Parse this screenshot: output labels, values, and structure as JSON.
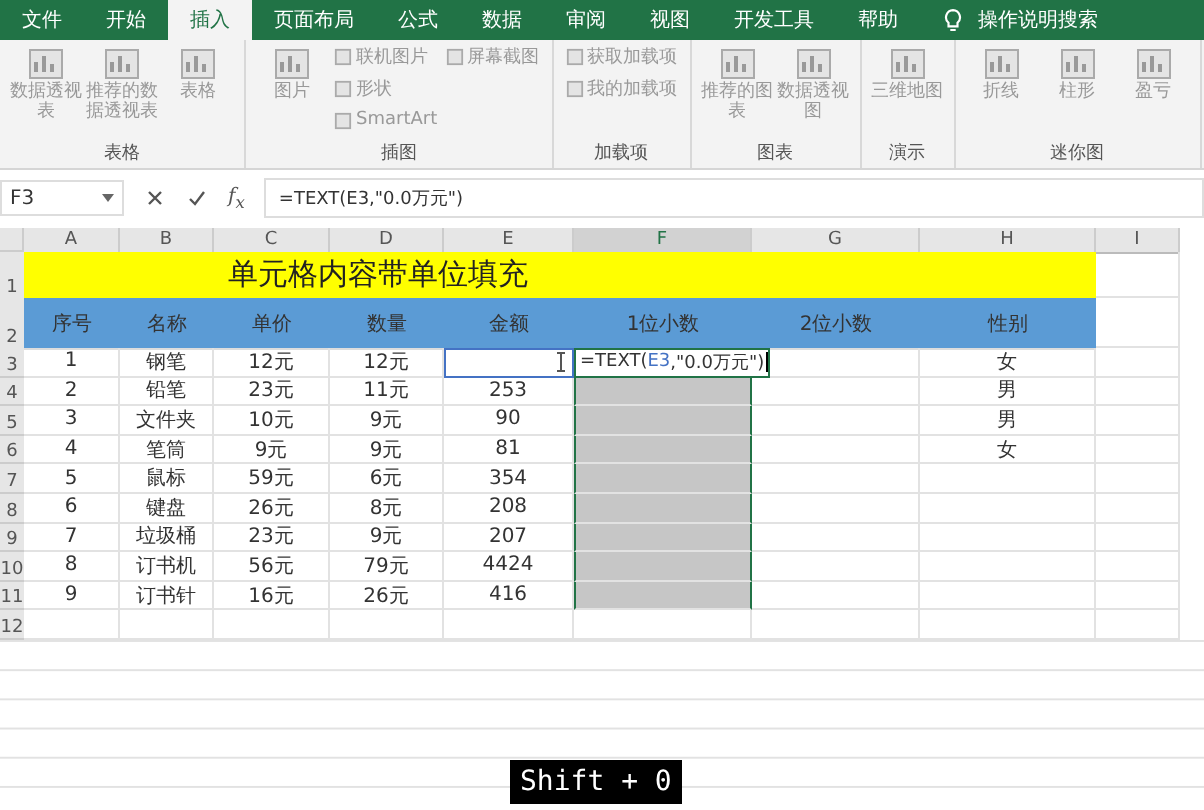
{
  "tabs": [
    {
      "label": "文件",
      "selected": false
    },
    {
      "label": "开始",
      "selected": false
    },
    {
      "label": "插入",
      "selected": true
    },
    {
      "label": "页面布局",
      "selected": false
    },
    {
      "label": "公式",
      "selected": false
    },
    {
      "label": "数据",
      "selected": false
    },
    {
      "label": "审阅",
      "selected": false
    },
    {
      "label": "视图",
      "selected": false
    },
    {
      "label": "开发工具",
      "selected": false
    },
    {
      "label": "帮助",
      "selected": false
    }
  ],
  "tell_me": "操作说明搜索",
  "ribbon_groups": [
    {
      "label": "表格",
      "items": [
        {
          "label": "数据透视表",
          "kind": "large"
        },
        {
          "label": "推荐的数据透视表",
          "kind": "large"
        },
        {
          "label": "表格",
          "kind": "large"
        }
      ]
    },
    {
      "label": "插图",
      "items": [
        {
          "label": "图片",
          "kind": "large"
        },
        {
          "label": "联机图片",
          "kind": "small"
        },
        {
          "label": "形状",
          "kind": "small"
        },
        {
          "label": "SmartArt",
          "kind": "small"
        },
        {
          "label": "屏幕截图",
          "kind": "small"
        }
      ]
    },
    {
      "label": "加载项",
      "items": [
        {
          "label": "获取加载项",
          "kind": "small"
        },
        {
          "label": "我的加载项",
          "kind": "small"
        }
      ]
    },
    {
      "label": "图表",
      "items": [
        {
          "label": "推荐的图表",
          "kind": "large"
        },
        {
          "label": "数据透视图",
          "kind": "large"
        }
      ]
    },
    {
      "label": "演示",
      "items": [
        {
          "label": "三维地图",
          "kind": "large"
        }
      ]
    },
    {
      "label": "迷你图",
      "items": [
        {
          "label": "折线",
          "kind": "large"
        },
        {
          "label": "柱形",
          "kind": "large"
        },
        {
          "label": "盈亏",
          "kind": "large"
        }
      ]
    }
  ],
  "name_box": "F3",
  "formula": "=TEXT(E3,\"0.0万元\")",
  "columns": [
    {
      "label": "A",
      "selected": false
    },
    {
      "label": "B",
      "selected": false
    },
    {
      "label": "C",
      "selected": false
    },
    {
      "label": "D",
      "selected": false
    },
    {
      "label": "E",
      "selected": false
    },
    {
      "label": "F",
      "selected": true
    },
    {
      "label": "G",
      "selected": false
    },
    {
      "label": "H",
      "selected": false
    },
    {
      "label": "I",
      "selected": false
    }
  ],
  "title_row": {
    "number": "1",
    "text": "单元格内容带单位填充"
  },
  "header_row": {
    "number": "2",
    "cells": [
      "序号",
      "名称",
      "单价",
      "数量",
      "金额",
      "1位小数",
      "2位小数",
      "性别"
    ]
  },
  "rows": [
    {
      "number": "3",
      "cells": [
        "1",
        "钢笔",
        "12元",
        "12元",
        "",
        "",
        "",
        "女"
      ],
      "selected": false,
      "formula_parts": [
        {
          "text": "=TEXT(",
          "kind": "plain"
        },
        {
          "text": "E3",
          "kind": "ref"
        },
        {
          "text": ",\"0.0万元\")",
          "kind": "plain"
        }
      ]
    },
    {
      "number": "4",
      "cells": [
        "2",
        "铅笔",
        "23元",
        "11元",
        "253",
        "",
        "",
        "男"
      ],
      "selected": true
    },
    {
      "number": "5",
      "cells": [
        "3",
        "文件夹",
        "10元",
        "9元",
        "90",
        "",
        "",
        "男"
      ],
      "selected": true
    },
    {
      "number": "6",
      "cells": [
        "4",
        "笔筒",
        "9元",
        "9元",
        "81",
        "",
        "",
        "女"
      ],
      "selected": true
    },
    {
      "number": "7",
      "cells": [
        "5",
        "鼠标",
        "59元",
        "6元",
        "354",
        "",
        "",
        ""
      ],
      "selected": true
    },
    {
      "number": "8",
      "cells": [
        "6",
        "键盘",
        "26元",
        "8元",
        "208",
        "",
        "",
        ""
      ],
      "selected": true
    },
    {
      "number": "9",
      "cells": [
        "7",
        "垃圾桶",
        "23元",
        "9元",
        "207",
        "",
        "",
        ""
      ],
      "selected": true
    },
    {
      "number": "10",
      "cells": [
        "8",
        "订书机",
        "56元",
        "79元",
        "4424",
        "",
        "",
        ""
      ],
      "selected": true
    },
    {
      "number": "11",
      "cells": [
        "9",
        "订书针",
        "16元",
        "26元",
        "416",
        "",
        "",
        ""
      ],
      "selected": true
    },
    {
      "number": "12",
      "cells": [
        "",
        "",
        "",
        "",
        "",
        "",
        "",
        ""
      ],
      "selected": false
    }
  ],
  "fx_label": "f$_{x}$",
  "key_overlay": "Shift + 0"
}
